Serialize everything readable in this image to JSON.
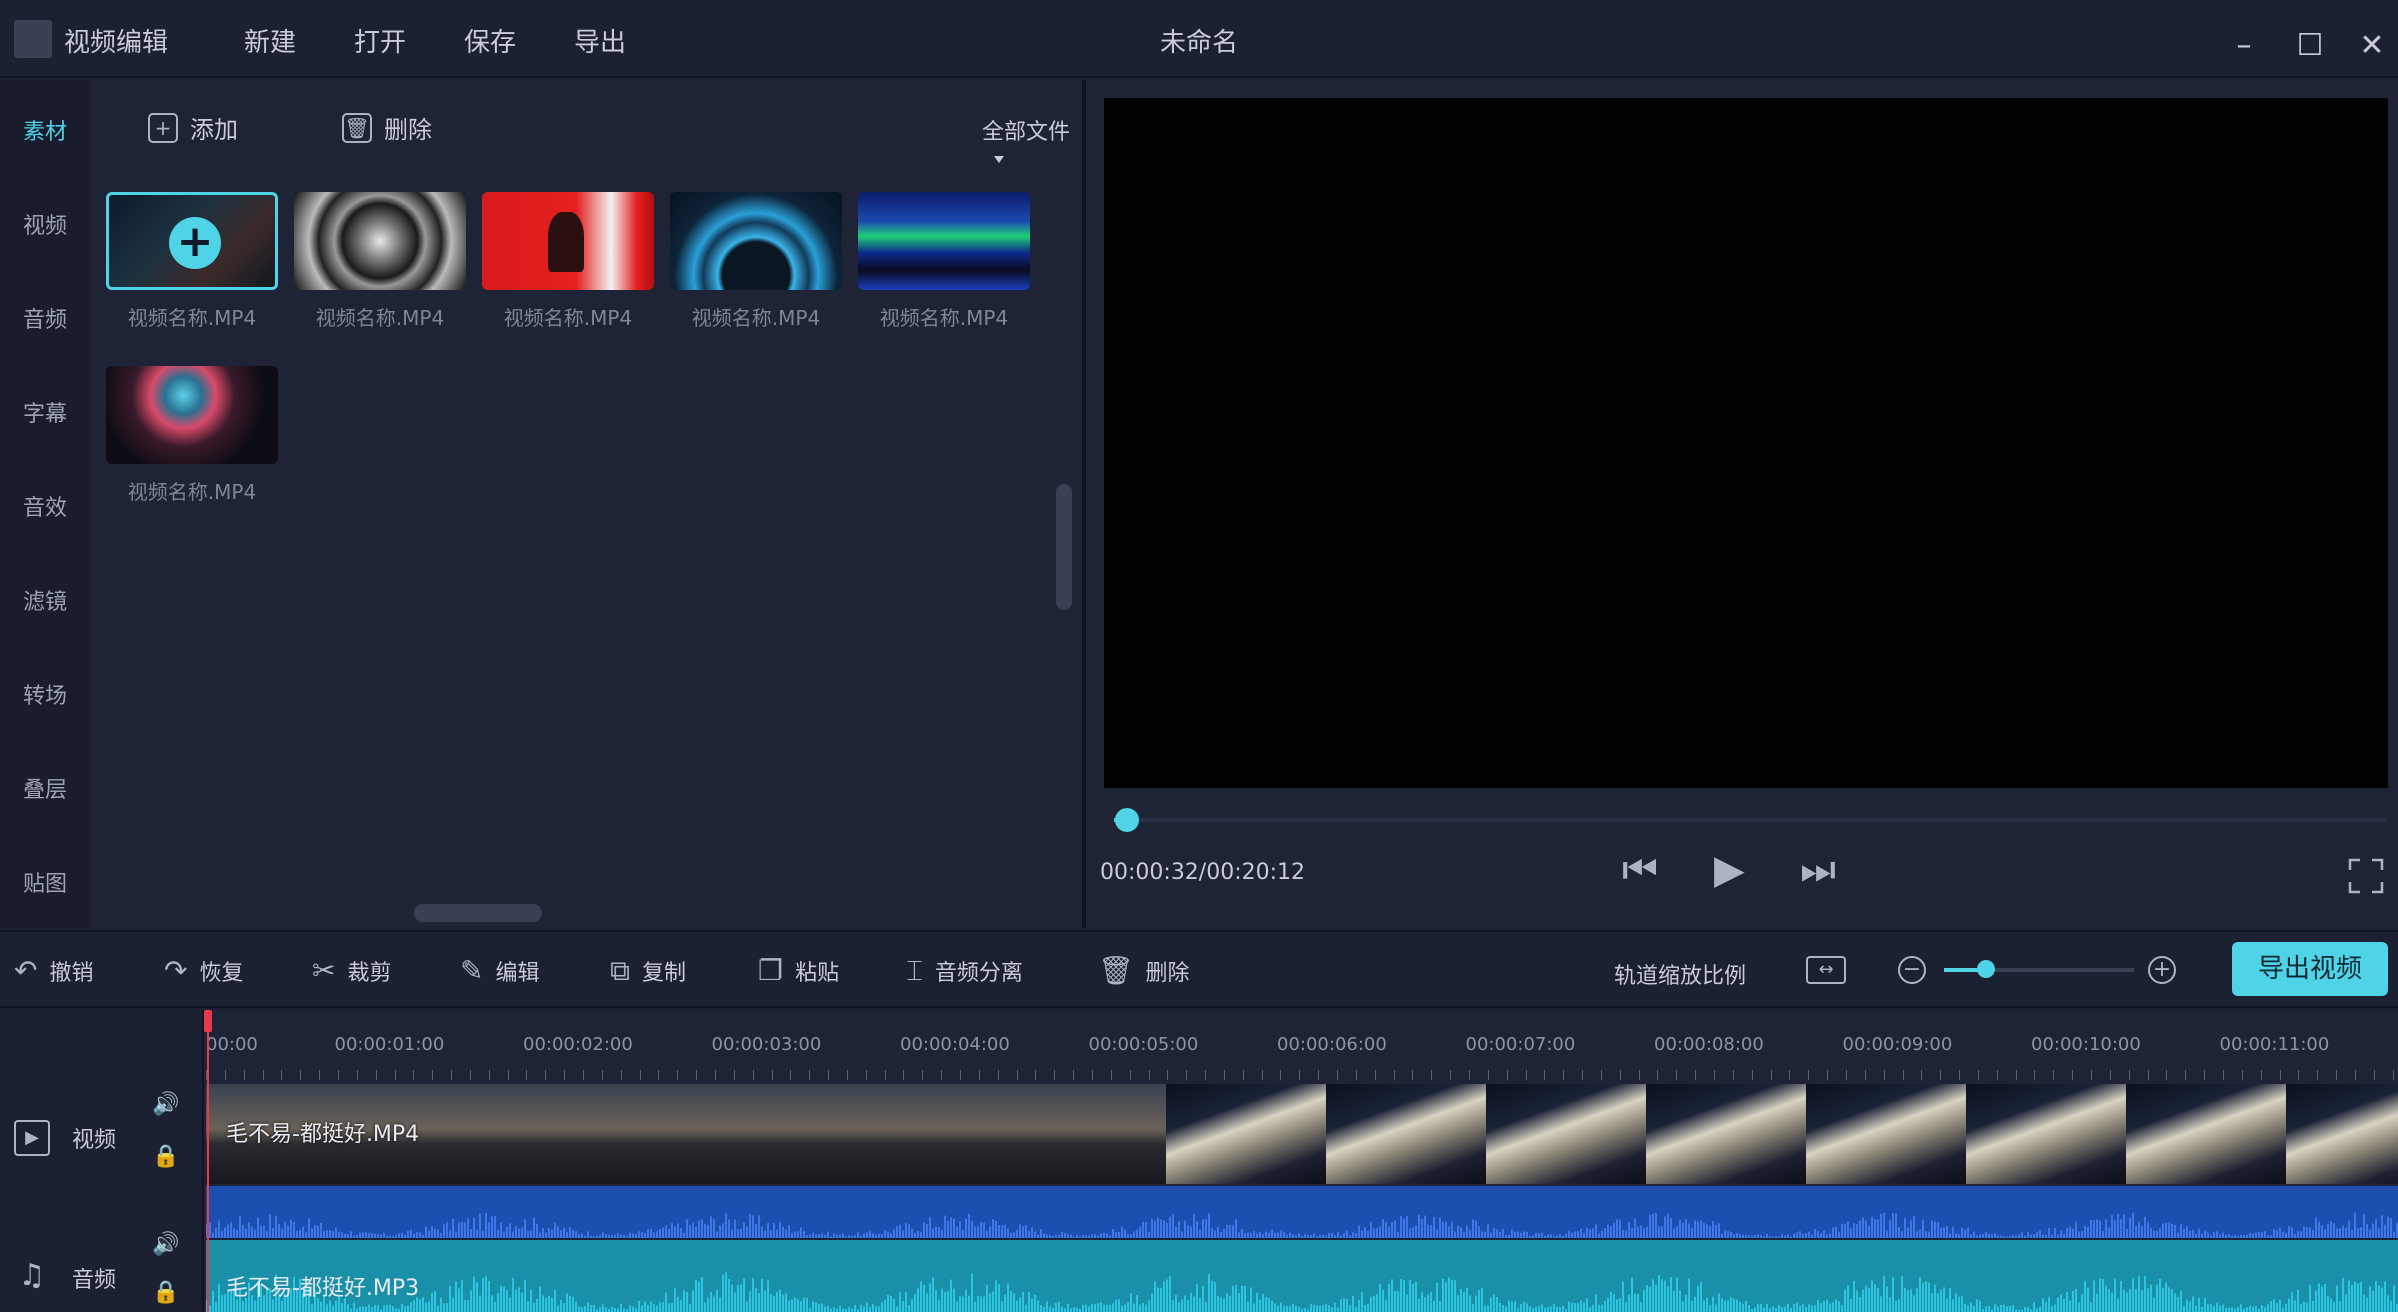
{
  "app": {
    "name": "视频编辑",
    "document_title": "未命名",
    "menu": [
      "新建",
      "打开",
      "保存",
      "导出"
    ],
    "window_controls": [
      "minimize-icon",
      "maximize-icon",
      "close-icon"
    ]
  },
  "library": {
    "categories": [
      "素材",
      "视频",
      "音频",
      "字幕",
      "音效",
      "滤镜",
      "转场",
      "叠层",
      "贴图"
    ],
    "active_category": "素材",
    "toolbar": {
      "add_label": "添加",
      "delete_label": "删除",
      "filter_value": "全部文件"
    },
    "items": [
      {
        "name": "视频名称.MP4",
        "selected": true,
        "thumb": "dark-scene"
      },
      {
        "name": "视频名称.MP4",
        "selected": false,
        "thumb": "hexagon-tunnel"
      },
      {
        "name": "视频名称.MP4",
        "selected": false,
        "thumb": "red-figure"
      },
      {
        "name": "视频名称.MP4",
        "selected": false,
        "thumb": "blue-ring"
      },
      {
        "name": "视频名称.MP4",
        "selected": false,
        "thumb": "aurora"
      },
      {
        "name": "视频名称.MP4",
        "selected": false,
        "thumb": "neon-portrait"
      }
    ]
  },
  "preview": {
    "time": "00:00:32/00:20:12",
    "progress": 0.01
  },
  "edit_toolbar": {
    "tools": [
      {
        "label": "撤销",
        "icon": "undo-icon"
      },
      {
        "label": "恢复",
        "icon": "redo-icon"
      },
      {
        "label": "裁剪",
        "icon": "scissors-icon"
      },
      {
        "label": "编辑",
        "icon": "pencil-icon"
      },
      {
        "label": "复制",
        "icon": "copy-icon"
      },
      {
        "label": "粘贴",
        "icon": "paste-icon"
      },
      {
        "label": "音频分离",
        "icon": "split-audio-icon"
      },
      {
        "label": "删除",
        "icon": "trash-icon"
      }
    ],
    "zoom_label": "轨道缩放比例",
    "zoom_level": 0.22,
    "export_label": "导出视频"
  },
  "timeline": {
    "ticks": [
      "00:00",
      "00:00:01:00",
      "00:00:02:00",
      "00:00:03:00",
      "00:00:04:00",
      "00:00:05:00",
      "00:00:06:00",
      "00:00:07:00",
      "00:00:08:00",
      "00:00:09:00",
      "00:00:10:00",
      "00:00:11:00"
    ],
    "tracks": [
      {
        "name": "视频",
        "clip": "毛不易-都挺好.MP4"
      },
      {
        "name": "音频",
        "clip": "毛不易-都挺好.MP3"
      }
    ]
  },
  "colors": {
    "accent": "#4fd3e6",
    "playhead": "#e63a4a",
    "video_audio_wave": "#1d4fb0",
    "audio_track": "#1a8fa8"
  }
}
